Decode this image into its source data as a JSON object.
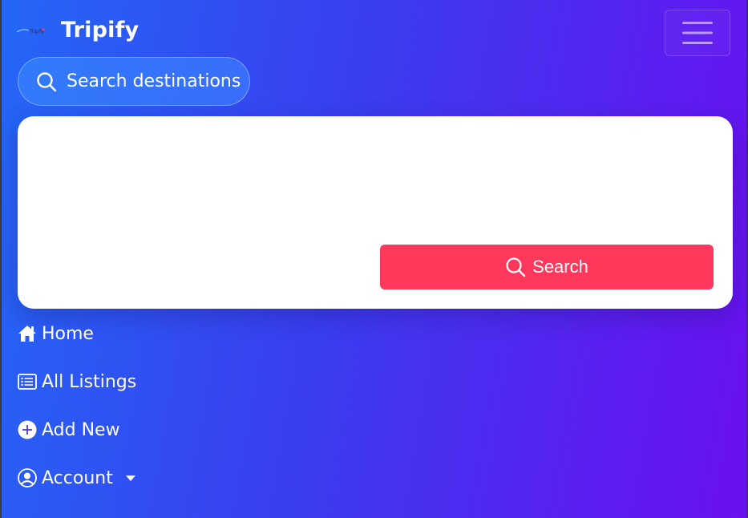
{
  "brand": {
    "name": "Tripify",
    "logo_text": "Tripify"
  },
  "header": {
    "menu_toggle_icon": "hamburger-icon"
  },
  "search_pill": {
    "label": "Search destinations",
    "icon": "search-icon"
  },
  "search_card": {
    "button_label": "Search",
    "button_icon": "search-icon",
    "button_color": "#ff385c"
  },
  "nav": {
    "items": [
      {
        "label": "Home",
        "icon": "house-icon"
      },
      {
        "label": "All Listings",
        "icon": "list-icon"
      },
      {
        "label": "Add New",
        "icon": "plus-circle-icon"
      },
      {
        "label": "Account",
        "icon": "user-circle-icon",
        "dropdown": true
      }
    ]
  },
  "colors": {
    "gradient_start": "#2467f6",
    "gradient_end": "#6b10ef",
    "accent": "#ff385c"
  }
}
